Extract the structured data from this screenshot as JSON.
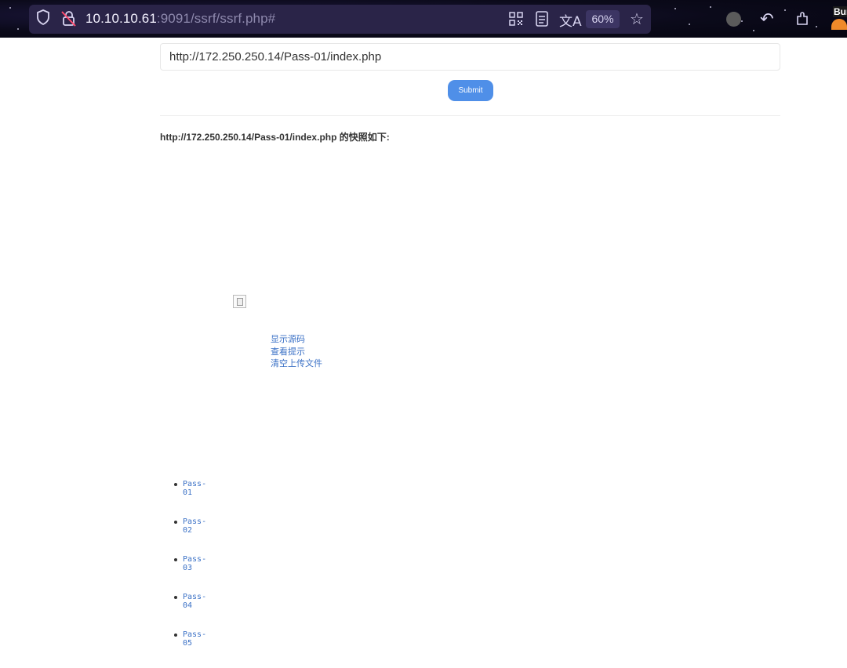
{
  "browser": {
    "url_host": "10.10.10.61",
    "url_rest": ":9091/ssrf/ssrf.php#",
    "zoom": "60%",
    "extension_label": "Bur",
    "icons": {
      "shield": "shield-icon",
      "lock_warning": "insecure-lock-icon",
      "qr": "qr-code-icon",
      "reader": "reader-view-icon",
      "translate": "translate-icon",
      "bookmark": "star-icon",
      "profile": "profile-icon",
      "back": "back-arrow-icon",
      "extensions": "extensions-icon",
      "burp": "burp-extension-icon"
    }
  },
  "form": {
    "url_value": "http://172.250.250.14/Pass-01/index.php",
    "submit_label": "Submit"
  },
  "snapshot": {
    "title": "http://172.250.250.14/Pass-01/index.php 的快照如下:"
  },
  "links": {
    "show_source": "显示源码",
    "view_hint": "查看提示",
    "clear_uploads": "清空上传文件"
  },
  "passes": [
    "Pass-01",
    "Pass-02",
    "Pass-03",
    "Pass-04",
    "Pass-05"
  ]
}
